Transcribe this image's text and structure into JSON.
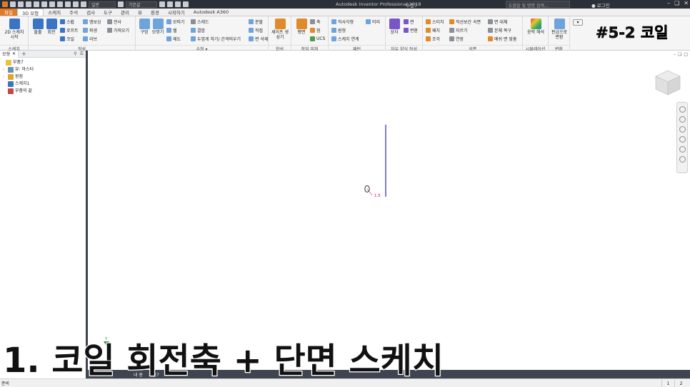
{
  "app": {
    "title": "Autodesk Inventor Professional 2018",
    "document": "부품7",
    "qat_material": "일반",
    "qat_appearance": "기본값",
    "search_placeholder": "도움말 및 명령 검색...",
    "login": "로그인"
  },
  "tabs": [
    "파일",
    "3D 모형",
    "스케치",
    "주석",
    "검사",
    "도구",
    "관리",
    "뷰",
    "환경",
    "시작하기",
    "Autodesk A360"
  ],
  "active_tab": "3D 모형",
  "ribbon": {
    "sketch_panel": {
      "title": "스케치",
      "start_sketch": "2D 스케치 시작"
    },
    "create_panel": {
      "title": "작성",
      "extrude": "돌출",
      "revolve": "회전",
      "sweep": "스윕",
      "loft": "로프트",
      "coil": "코일",
      "emboss": "엠보싱",
      "derive": "파생",
      "rib": "리브",
      "decal": "전사",
      "import": "가져오기"
    },
    "modify_panel": {
      "title": "수정",
      "hole": "구멍",
      "fillet": "모깎기",
      "chamfer": "모따기",
      "shell": "쉘",
      "draft": "제도",
      "thread": "스레드",
      "combine": "결합",
      "thicken": "두껍게 하기/ 간격띄우기",
      "split": "분할",
      "direct": "직접",
      "delete_face": "면 삭제"
    },
    "assemble_panel": {
      "title": "합석",
      "shape_generator": "셰이프 생성기"
    },
    "work_features_panel": {
      "title": "작업 피쳐",
      "plane": "평면",
      "axis": "축",
      "point": "점",
      "ucs": "UCS"
    },
    "pattern_panel": {
      "title": "패턴",
      "rectangular": "직사각형",
      "circular": "원형",
      "sketch_driven": "스케치 연계",
      "mirror": "미러"
    },
    "freeform_panel": {
      "title": "자유 양식 작성",
      "box": "상자",
      "face": "면",
      "convert": "변환"
    },
    "surface_panel": {
      "title": "곡면",
      "stitch": "스티치",
      "patch": "패치",
      "sculpt": "조각",
      "ruled": "직선보간 곡면",
      "trim": "자르기",
      "extend": "연장",
      "replace_face": "면 대체",
      "repair": "본체 복구",
      "fit_mesh": "메쉬 면 맞춤"
    },
    "simulation_panel": {
      "title": "시뮬레이션",
      "stress": "응력 해석"
    },
    "convert_panel": {
      "title": "변환",
      "sheet_metal": "판금으로 변환"
    }
  },
  "overlay_title": "#5-2 코일",
  "browser": {
    "tab_label": "모형",
    "tree": [
      {
        "label": "부품7",
        "icon": "part-icon",
        "level": 0,
        "color": "#e9c23a"
      },
      {
        "label": "뷰: 마스터",
        "icon": "view-icon",
        "level": 1,
        "color": "#6b8fb5"
      },
      {
        "label": "원점",
        "icon": "folder-icon",
        "level": 1,
        "color": "#e0a62a"
      },
      {
        "label": "스케치1",
        "icon": "sketch-icon",
        "level": 1,
        "color": "#3a74c4"
      },
      {
        "label": "부품의 끝",
        "icon": "end-of-part-icon",
        "level": 1,
        "color": "#c84646"
      }
    ]
  },
  "viewport": {
    "dimension_label": "1.5",
    "axis_label": "Y"
  },
  "bottom_tabs": [
    "내 홈",
    "부품7"
  ],
  "status": {
    "text": "준비",
    "box1": "1",
    "box2": "2"
  },
  "caption": "1. 코일 회전축 + 단면 스케치"
}
